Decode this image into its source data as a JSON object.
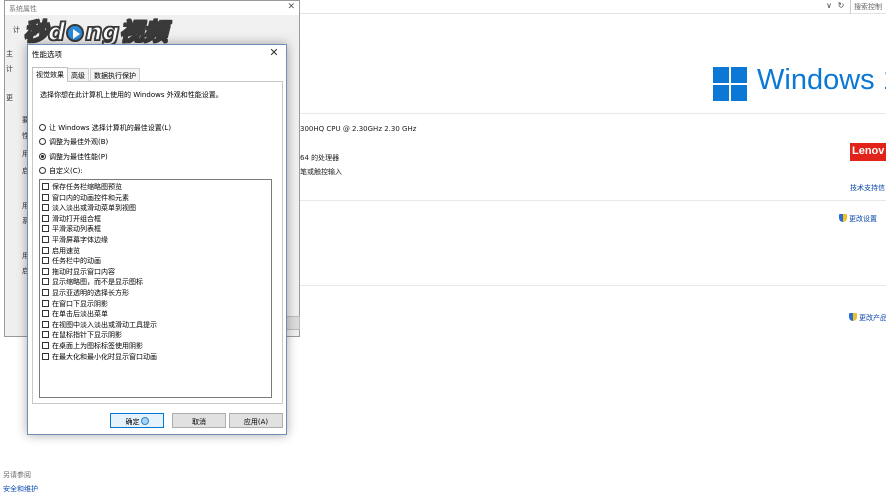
{
  "control_panel": {
    "search_placeholder": "搜索控制",
    "nav_chevron": "∨",
    "nav_refresh": "↻",
    "windows_brand": "Windows 1",
    "cpu_text": "300HQ CPU @ 2.30GHz   2.30 GHz",
    "system_type_text": "64 的处理器",
    "pen_text": "笔或触控输入",
    "lenovo_text": "Lenov",
    "support_link": "技术支持信",
    "change_settings_link": "更改设置",
    "change_product_link": "更改产品",
    "see_also": "另请参阅",
    "security_link": "安全和维护"
  },
  "system_properties": {
    "title": "系统属性",
    "close": "✕",
    "fragments": [
      "计",
      "主",
      "计",
      "更",
      "要",
      "性",
      "用",
      "启",
      "用",
      "系",
      "用",
      "启"
    ]
  },
  "watermark": {
    "part1": "秒d",
    "part2": "ng视频"
  },
  "dialog": {
    "title": "性能选项",
    "close": "✕",
    "tabs": [
      "视觉效果",
      "高级",
      "数据执行保护"
    ],
    "description": "选择你想在此计算机上使用的 Windows 外观和性能设置。",
    "radios": [
      {
        "label": "让 Windows 选择计算机的最佳设置(L)",
        "selected": false
      },
      {
        "label": "调整为最佳外观(B)",
        "selected": false
      },
      {
        "label": "调整为最佳性能(P)",
        "selected": true
      },
      {
        "label": "自定义(C):",
        "selected": false
      }
    ],
    "checkboxes": [
      "保存任务栏缩略图预览",
      "窗口内的动画控件和元素",
      "淡入淡出或滑动菜单到视图",
      "滑动打开组合框",
      "平滑滚动列表框",
      "平滑屏幕字体边缘",
      "启用速览",
      "任务栏中的动画",
      "拖动时显示窗口内容",
      "显示缩略图，而不是显示图标",
      "显示亚透明的选择长方形",
      "在窗口下显示阴影",
      "在单击后淡出菜单",
      "在视图中淡入淡出或滑动工具提示",
      "在鼠标指针下显示阴影",
      "在桌面上为图标标签使用阴影",
      "在最大化和最小化时显示窗口动画"
    ],
    "buttons": {
      "ok": "确定",
      "cancel": "取消",
      "apply": "应用(A)"
    }
  }
}
